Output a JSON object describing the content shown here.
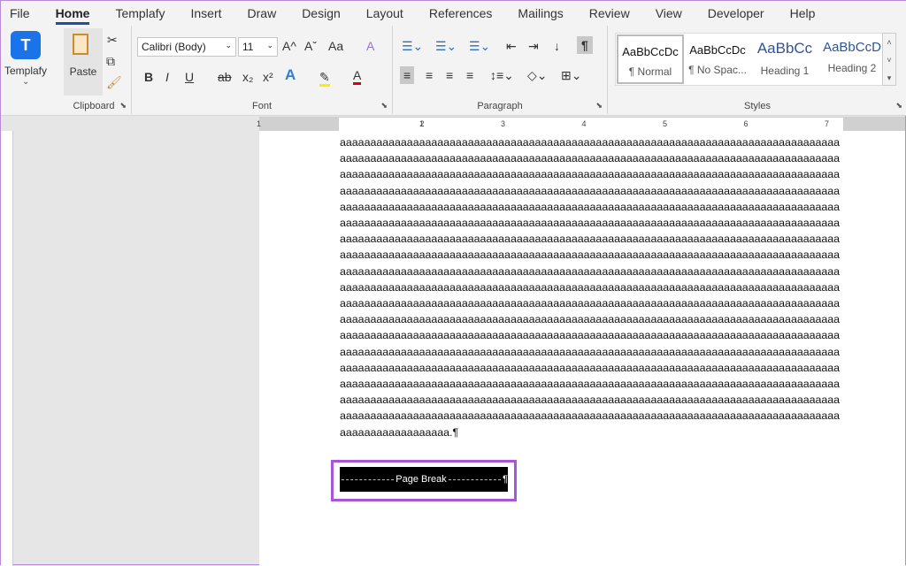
{
  "menu": {
    "tabs": [
      "File",
      "Home",
      "Templafy",
      "Insert",
      "Draw",
      "Design",
      "Layout",
      "References",
      "Mailings",
      "Review",
      "View",
      "Developer",
      "Help"
    ],
    "active": "Home"
  },
  "ribbon": {
    "templafy": {
      "label": "Templafy",
      "letter": "T",
      "color": "#1a73e8"
    },
    "clipboard": {
      "paste": "Paste",
      "group": "Clipboard"
    },
    "font": {
      "name": "Calibri (Body)",
      "size": "11",
      "group": "Font",
      "bold": "B",
      "italic": "I",
      "underline": "U",
      "strike": "ab",
      "sub": "x₂",
      "sup": "x²",
      "case": "Aa",
      "grow": "A^",
      "shrink": "Aˇ"
    },
    "paragraph": {
      "group": "Paragraph",
      "pilcrow": "¶"
    },
    "styles": {
      "group": "Styles",
      "items": [
        {
          "preview": "AaBbCcDc",
          "name": "¶ Normal"
        },
        {
          "preview": "AaBbCcDc",
          "name": "¶ No Spac..."
        },
        {
          "preview": "AaBbCc",
          "name": "Heading 1"
        },
        {
          "preview": "AaBbCcD",
          "name": "Heading 2"
        }
      ]
    }
  },
  "ruler": [
    "1",
    "1",
    "2",
    "3",
    "4",
    "5",
    "6",
    "7"
  ],
  "document": {
    "line": "aaaaaaaaaaaaaaaaaaaaaaaaaaaaaaaaaaaaaaaaaaaaaaaaaaaaaaaaaaaaaaaaaaaaaaaaaaaaaaaaaa",
    "line_count": 18,
    "last_line": "aaaaaaaaaaaaaaaaaa.¶",
    "page_break": "Page Break",
    "break_mark": "¶",
    "highlight_color": "#a855d8"
  }
}
